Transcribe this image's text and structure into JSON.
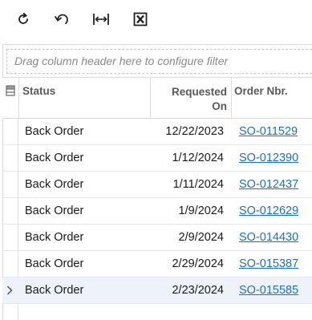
{
  "toolbar": {
    "buttons": [
      {
        "name": "refresh-icon"
      },
      {
        "name": "undo-icon"
      },
      {
        "name": "fit-columns-icon"
      },
      {
        "name": "export-excel-icon"
      }
    ]
  },
  "filter": {
    "placeholder": "Drag column header here to configure filter"
  },
  "columns": {
    "status": "Status",
    "requested_on_line1": "Requested",
    "requested_on_line2": "On",
    "order_nbr": "Order Nbr."
  },
  "rows": [
    {
      "status": "Back Order",
      "requested_on": "12/22/2023",
      "order_nbr": "SO-011529"
    },
    {
      "status": "Back Order",
      "requested_on": "1/12/2024",
      "order_nbr": "SO-012390"
    },
    {
      "status": "Back Order",
      "requested_on": "1/11/2024",
      "order_nbr": "SO-012437"
    },
    {
      "status": "Back Order",
      "requested_on": "1/9/2024",
      "order_nbr": "SO-012629"
    },
    {
      "status": "Back Order",
      "requested_on": "2/9/2024",
      "order_nbr": "SO-014430"
    },
    {
      "status": "Back Order",
      "requested_on": "2/29/2024",
      "order_nbr": "SO-015387"
    },
    {
      "status": "Back Order",
      "requested_on": "2/23/2024",
      "order_nbr": "SO-015585"
    }
  ],
  "active_row_index": 6,
  "colors": {
    "link": "#1a6fc7",
    "active_row": "#eef3fb"
  }
}
